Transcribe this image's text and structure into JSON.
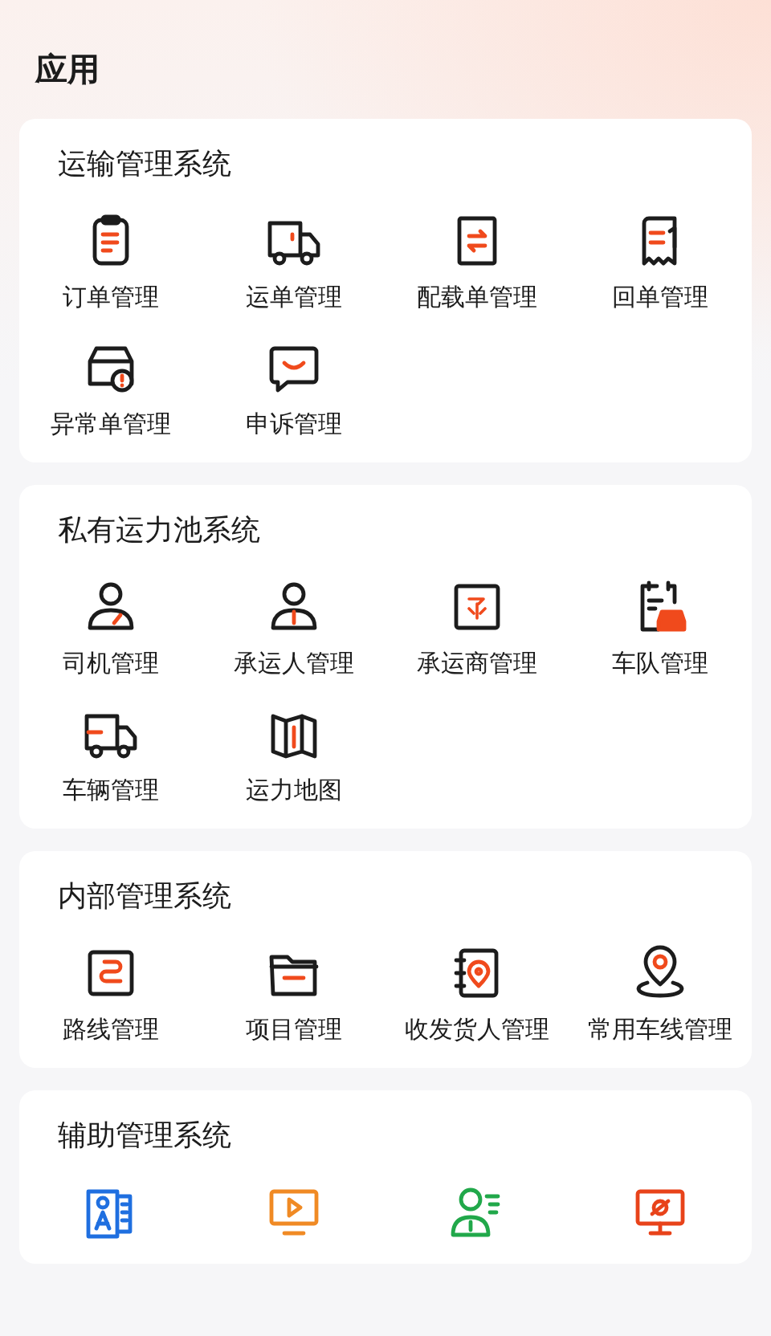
{
  "page_title": "应用",
  "sections": [
    {
      "title": "运输管理系统",
      "items": [
        {
          "kind": "tile",
          "label": "订单管理"
        },
        {
          "kind": "tile",
          "label": "运单管理"
        },
        {
          "kind": "tile",
          "label": "配载单管理"
        },
        {
          "kind": "tile",
          "label": "回单管理"
        },
        {
          "kind": "tile",
          "label": "异常单管理"
        },
        {
          "kind": "tile",
          "label": "申诉管理"
        }
      ]
    },
    {
      "title": "私有运力池系统",
      "items": [
        {
          "kind": "tile",
          "label": "司机管理"
        },
        {
          "kind": "tile",
          "label": "承运人管理"
        },
        {
          "kind": "tile",
          "label": "承运商管理"
        },
        {
          "kind": "tile",
          "label": "车队管理"
        },
        {
          "kind": "tile",
          "label": "车辆管理"
        },
        {
          "kind": "tile",
          "label": "运力地图"
        }
      ]
    },
    {
      "title": "内部管理系统",
      "items": [
        {
          "kind": "tile",
          "label": "路线管理"
        },
        {
          "kind": "tile",
          "label": "项目管理"
        },
        {
          "kind": "tile",
          "label": "收发货人管理"
        },
        {
          "kind": "tile",
          "label": "常用车线管理"
        }
      ]
    },
    {
      "title": "辅助管理系统",
      "items": [
        {
          "kind": "icon_only"
        },
        {
          "kind": "icon_only"
        },
        {
          "kind": "icon_only"
        },
        {
          "kind": "icon_only"
        }
      ]
    }
  ]
}
